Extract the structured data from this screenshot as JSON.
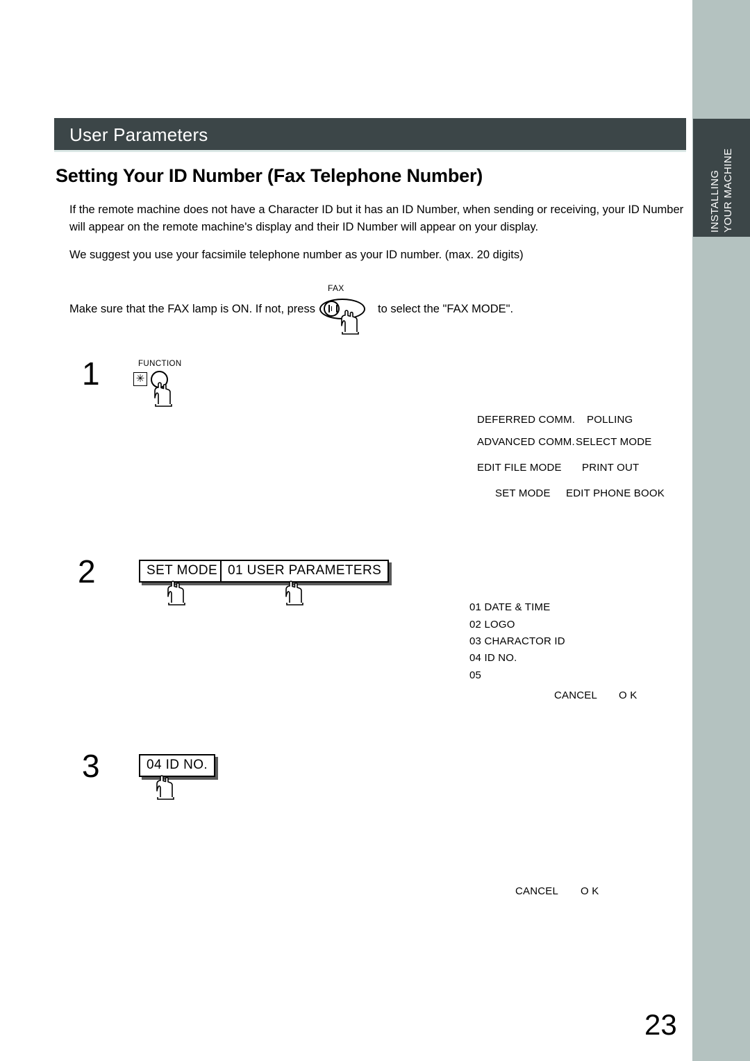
{
  "document": {
    "page_number": "23",
    "chapter_tab": {
      "line1": "INSTALLING",
      "line2": "YOUR MACHINE"
    },
    "section_bar_title": "User Parameters",
    "page_heading": "Setting Your ID Number (Fax Telephone Number)",
    "paragraph_1": "If the remote machine does not have a Character ID but it has an ID Number, when sending or receiving, your ID Number will appear on the remote machine's display and their ID Number will appear on your display.",
    "paragraph_2": "We suggest you use your facsimile telephone number as your ID number. (max. 20 digits)"
  },
  "fax_line": {
    "text_before": "Make sure that the FAX lamp is ON.  If not, press",
    "button_caption": "FAX",
    "text_after": "to select the \"FAX MODE\"."
  },
  "steps": [
    {
      "number": "1",
      "key_caption": "FUNCTION",
      "key_star": "✳",
      "lcd": {
        "rows": [
          {
            "left": "DEFERRED COMM.",
            "right": "POLLING"
          },
          {
            "left": "ADVANCED COMM.",
            "right": "SELECT MODE"
          },
          {
            "left": "EDIT FILE MODE",
            "right": "PRINT OUT"
          },
          {
            "left": "SET MODE",
            "right": "EDIT PHONE BOOK"
          }
        ]
      }
    },
    {
      "number": "2",
      "buttons": [
        {
          "label": "SET MODE"
        },
        {
          "label": "01  USER PARAMETERS"
        }
      ],
      "lcd": {
        "items": [
          "01 DATE & TIME",
          "02 LOGO",
          "03 CHARACTOR ID",
          "04 ID NO.",
          "05"
        ],
        "cancel": "CANCEL",
        "ok": "O K"
      }
    },
    {
      "number": "3",
      "buttons": [
        {
          "label": "04 ID NO."
        }
      ],
      "lcd": {
        "cancel": "CANCEL",
        "ok": "O K"
      }
    }
  ],
  "colors": {
    "header_bar": "#3c4648",
    "edge_strip": "#b4c2c0",
    "header_underline": "#dbe8e6",
    "button_shadow": "#5a5a5a",
    "text": "#000000"
  },
  "icons": {
    "hand_pointer": "hand-pointer-icon",
    "fax_key": "fax-key-icon",
    "function_key": "function-key-icon"
  }
}
